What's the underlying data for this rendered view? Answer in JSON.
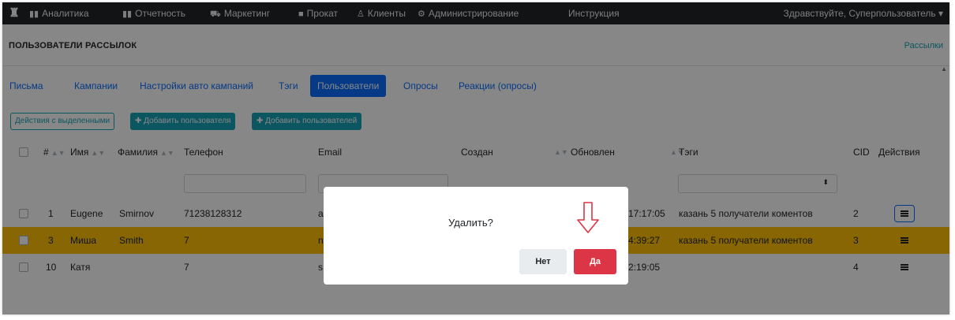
{
  "nav": {
    "items": [
      {
        "icon": "bar-chart-icon",
        "label": "Аналитика"
      },
      {
        "icon": "bar-chart-icon",
        "label": "Отчетность"
      },
      {
        "icon": "cart-icon",
        "label": "Маркетинг"
      },
      {
        "icon": "film-icon",
        "label": "Прокат"
      },
      {
        "icon": "user-icon",
        "label": "Клиенты"
      },
      {
        "icon": "gears-icon",
        "label": "Администрирование"
      },
      {
        "icon": "",
        "label": "Инструкция"
      }
    ],
    "greeting": "Здравствуйте, Суперпользователь ▾"
  },
  "page": {
    "title": "ПОЛЬЗОВАТЕЛИ РАССЫЛОК",
    "breadcrumb": "Рассылки"
  },
  "tabs": [
    {
      "label": "Письма",
      "active": false
    },
    {
      "label": "Кампании",
      "active": false
    },
    {
      "label": "Настройки авто кампаний",
      "active": false
    },
    {
      "label": "Тэги",
      "active": false
    },
    {
      "label": "Пользователи",
      "active": true
    },
    {
      "label": "Опросы",
      "active": false
    },
    {
      "label": "Реакции (опросы)",
      "active": false
    }
  ],
  "actions": {
    "bulk": "Действия с выделенными",
    "add_user": "✚ Добавить пользователя",
    "add_users": "✚ Добавить пользователей"
  },
  "table": {
    "columns": [
      "#",
      "Имя",
      "Фамилия",
      "Телефон",
      "Email",
      "Создан",
      "Обновлен",
      "Тэги",
      "CID",
      "Действия"
    ],
    "rows": [
      {
        "id": "1",
        "first": "Eugene",
        "last": "Smirnov",
        "phone": "71238128312",
        "email": "a",
        "updated": "17:17:05",
        "tags": "казань 5 получатели коментов",
        "cid": "2",
        "highlight": false
      },
      {
        "id": "3",
        "first": "Миша",
        "last": "Smith",
        "phone": "7",
        "email": "n",
        "updated": "4:39:27",
        "tags": "казань 5 получатели коментов",
        "cid": "3",
        "highlight": true
      },
      {
        "id": "10",
        "first": "Катя",
        "last": "",
        "phone": "7",
        "email": "s",
        "updated": "2:19:05",
        "tags": "",
        "cid": "4",
        "highlight": false
      }
    ]
  },
  "modal": {
    "question": "Удалить?",
    "no_label": "Нет",
    "yes_label": "Да"
  },
  "colors": {
    "navbar": "#212529",
    "primary": "#0d6efd",
    "info": "#17a2b8",
    "danger": "#dc3545",
    "highlight_row": "#ffc107"
  }
}
